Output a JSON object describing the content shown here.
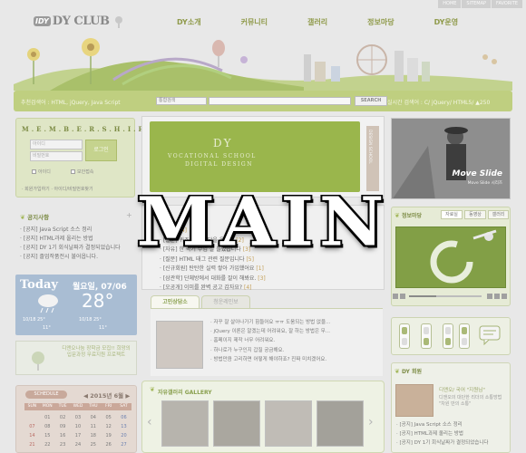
{
  "colors": {
    "accent": "#bfcf80",
    "title_green": "#7d8c46",
    "nav": "#8f9a4a"
  },
  "top_links": [
    "HOME",
    "SITEMAP",
    "FAVORITE"
  ],
  "logo": {
    "mark": "IDY",
    "text": "DY CLUB"
  },
  "gnb": [
    "DY소개",
    "커뮤니티",
    "갤러리",
    "정보마당",
    "DY운영"
  ],
  "search": {
    "label": "추천검색어 : HTML, jQuery, Java Script",
    "select_value": "통합검색",
    "button": "SEARCH",
    "realtime": "실시간 검색어 : C/ jQuery/ HTML5/ ▲250"
  },
  "member": {
    "title": "M.E.M.B.E.R.S.H.I.P",
    "id_placeholder": "아이디",
    "pw_placeholder": "비밀번호",
    "login": "로그인",
    "remember_id": "아이디",
    "secure": "보안접속",
    "links": "· 회원가입하기 · 아이디/비밀번호찾기"
  },
  "notice": {
    "title": "공지사항",
    "items": [
      "· [공지] Java Script 소스 정리",
      "· [공지] HTML과제 올리는 방법",
      "· [공지] DY 1기 회식날짜가 결정되었습니다",
      "· [공지] 졸업작품전시 불어옵니다."
    ]
  },
  "weather": {
    "today": "Today",
    "date": "월요일, 07/06",
    "temp": "28°",
    "row1a": "10/18  25°",
    "row1b": "10/18  25°",
    "row2a": "11°",
    "row2b": "11°"
  },
  "promo": {
    "text": "디앤오나눔 장학금 모집!! 희망의 입문과정 무료지원 프로젝트"
  },
  "schedule": {
    "tag": "SCHEDULE",
    "month": "◀ 2015년 6월 ▶",
    "days": [
      "SUN",
      "MON",
      "TUE",
      "WED",
      "THU",
      "FRI",
      "SAT"
    ],
    "weeks": [
      [
        "",
        "01",
        "02",
        "03",
        "04",
        "05",
        "06"
      ],
      [
        "07",
        "08",
        "09",
        "10",
        "11",
        "12",
        "13"
      ],
      [
        "14",
        "15",
        "16",
        "17",
        "18",
        "19",
        "20"
      ],
      [
        "21",
        "22",
        "23",
        "24",
        "25",
        "26",
        "27"
      ]
    ]
  },
  "hero": {
    "dy": "DY",
    "sub1": "VOCATIONAL SCHOOL",
    "sub2": "DIGITAL DESIGN",
    "side": "DESIGN SCHOOL"
  },
  "board": {
    "title": "",
    "items": [
      {
        "tag": "",
        "text": "· [공지] ",
        "count": "[4]"
      },
      {
        "tag": "",
        "text": "· [질문] 퀴즈 과제 정답을 올리면 ",
        "count": "[2]"
      },
      {
        "tag": "",
        "text": "· [자유] 한 학기 수업 잘 들었습니다 ",
        "count": "[3]"
      },
      {
        "tag": "",
        "text": "· [질문] HTML 태그 관련 질문입니다 ",
        "count": "[5]"
      },
      {
        "tag": "",
        "text": "· [신규회원] 탄탄한 실력 쌓아 가입했어요 ",
        "count": "[1]"
      },
      {
        "tag": "",
        "text": "· [삼관학] 단체방에서 대화를 잘이 해봐요. ",
        "count": "[3]"
      },
      {
        "tag": "",
        "text": "· [오공개] 이미를 완벽 공고 갑자요? ",
        "count": "[4]"
      }
    ]
  },
  "counsel": {
    "tab1": "고민상담소",
    "tab2": "청운레인보",
    "items": [
      "· 자꾸 잘 살아나가기 힘들어요 ㅠㅠ 도움되는 방법 없을...",
      "· jQuery 이론은 알겠는데 어려워요, 잘 하는 방법은 무...",
      "· 홈페이지 제작 너무 어려워요.",
      "· 하나로가 누구인지 갑질 궁금해요.",
      "· 방법만큼 고리하면 어떻게 해야하죠? 진짜 미치겠어요."
    ]
  },
  "gallery": {
    "title": "자유갤러리 GALLERY"
  },
  "moveslide": {
    "title": "Move Slide",
    "sub": "Move Slide 시리즈"
  },
  "info": {
    "title": "정보마당",
    "tabs": [
      "자료실",
      "동영상",
      "갤러리"
    ]
  },
  "profile": {
    "title": "DY 회원",
    "name": "디앤오/ 국어 \"지원님\"",
    "desc": "디앤오의 대단한 리더의 소통방법 \"차원 만의 소통\"",
    "items": [
      "· [공지] Java Script 소스 정리",
      "· [공지] HTML과제 올리는 방법",
      "· [공지] DY 1기 회식날짜가 결정되었습니다"
    ]
  },
  "overlay": {
    "text": "MAIN"
  }
}
